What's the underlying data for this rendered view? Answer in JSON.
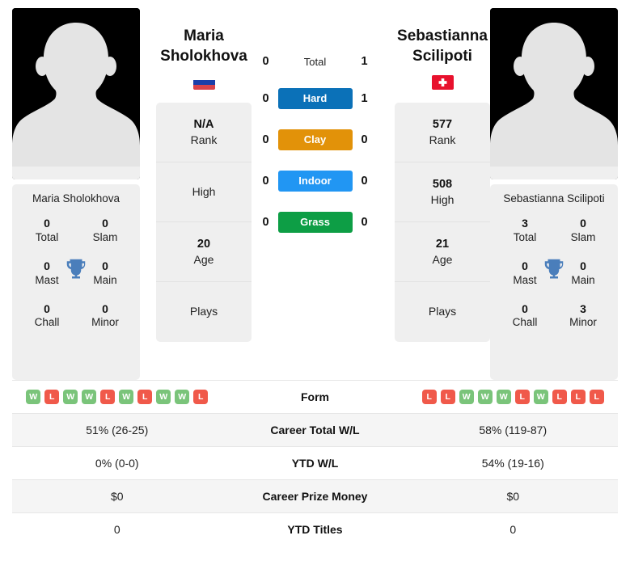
{
  "players": {
    "left": {
      "first_name": "Maria",
      "last_name": "Sholokhova",
      "full_name": "Maria Sholokhova",
      "country_flag": "russia-flag",
      "info": [
        {
          "value": "N/A",
          "label": "Rank"
        },
        {
          "value": "",
          "label": "High"
        },
        {
          "value": "20",
          "label": "Age"
        },
        {
          "value": "",
          "label": "Plays"
        }
      ],
      "titles": [
        {
          "value": "0",
          "label": "Total"
        },
        {
          "value": "0",
          "label": "Slam"
        },
        {
          "value": "0",
          "label": "Mast"
        },
        {
          "value": "0",
          "label": "Main"
        },
        {
          "value": "0",
          "label": "Chall"
        },
        {
          "value": "0",
          "label": "Minor"
        }
      ],
      "form": [
        "W",
        "L",
        "W",
        "W",
        "L",
        "W",
        "L",
        "W",
        "W",
        "L"
      ],
      "career_total_wl": "51% (26-25)",
      "ytd_wl": "0% (0-0)",
      "career_prize_money": "$0",
      "ytd_titles": "0"
    },
    "right": {
      "first_name": "Sebastianna",
      "last_name": "Scilipoti",
      "full_name": "Sebastianna Scilipoti",
      "country_flag": "switzerland-flag",
      "info": [
        {
          "value": "577",
          "label": "Rank"
        },
        {
          "value": "508",
          "label": "High"
        },
        {
          "value": "21",
          "label": "Age"
        },
        {
          "value": "",
          "label": "Plays"
        }
      ],
      "titles": [
        {
          "value": "3",
          "label": "Total"
        },
        {
          "value": "0",
          "label": "Slam"
        },
        {
          "value": "0",
          "label": "Mast"
        },
        {
          "value": "0",
          "label": "Main"
        },
        {
          "value": "0",
          "label": "Chall"
        },
        {
          "value": "3",
          "label": "Minor"
        }
      ],
      "form": [
        "L",
        "L",
        "W",
        "W",
        "W",
        "L",
        "W",
        "L",
        "L",
        "L"
      ],
      "career_total_wl": "58% (119-87)",
      "ytd_wl": "54% (19-16)",
      "career_prize_money": "$0",
      "ytd_titles": "0"
    }
  },
  "head_to_head": {
    "total": {
      "label": "Total",
      "left": "0",
      "right": "1"
    },
    "surfaces": [
      {
        "label": "Hard",
        "left": "0",
        "right": "1",
        "color": "#0b71b8"
      },
      {
        "label": "Clay",
        "left": "0",
        "right": "0",
        "color": "#e29209"
      },
      {
        "label": "Indoor",
        "left": "0",
        "right": "0",
        "color": "#2196f3"
      },
      {
        "label": "Grass",
        "left": "0",
        "right": "0",
        "color": "#0d9e45"
      }
    ]
  },
  "stats_rows": [
    {
      "label": "Form",
      "type": "form"
    },
    {
      "label": "Career Total W/L",
      "type": "text",
      "key": "career_total_wl"
    },
    {
      "label": "YTD W/L",
      "type": "text",
      "key": "ytd_wl"
    },
    {
      "label": "Career Prize Money",
      "type": "text",
      "key": "career_prize_money"
    },
    {
      "label": "YTD Titles",
      "type": "text",
      "key": "ytd_titles"
    }
  ],
  "colors": {
    "win": "#7ac47a",
    "loss": "#f0594a",
    "trophy": "#4a7ebb",
    "card_bg": "#efefef"
  },
  "icons": {
    "trophy": "trophy-icon",
    "avatar": "avatar-placeholder-icon"
  }
}
